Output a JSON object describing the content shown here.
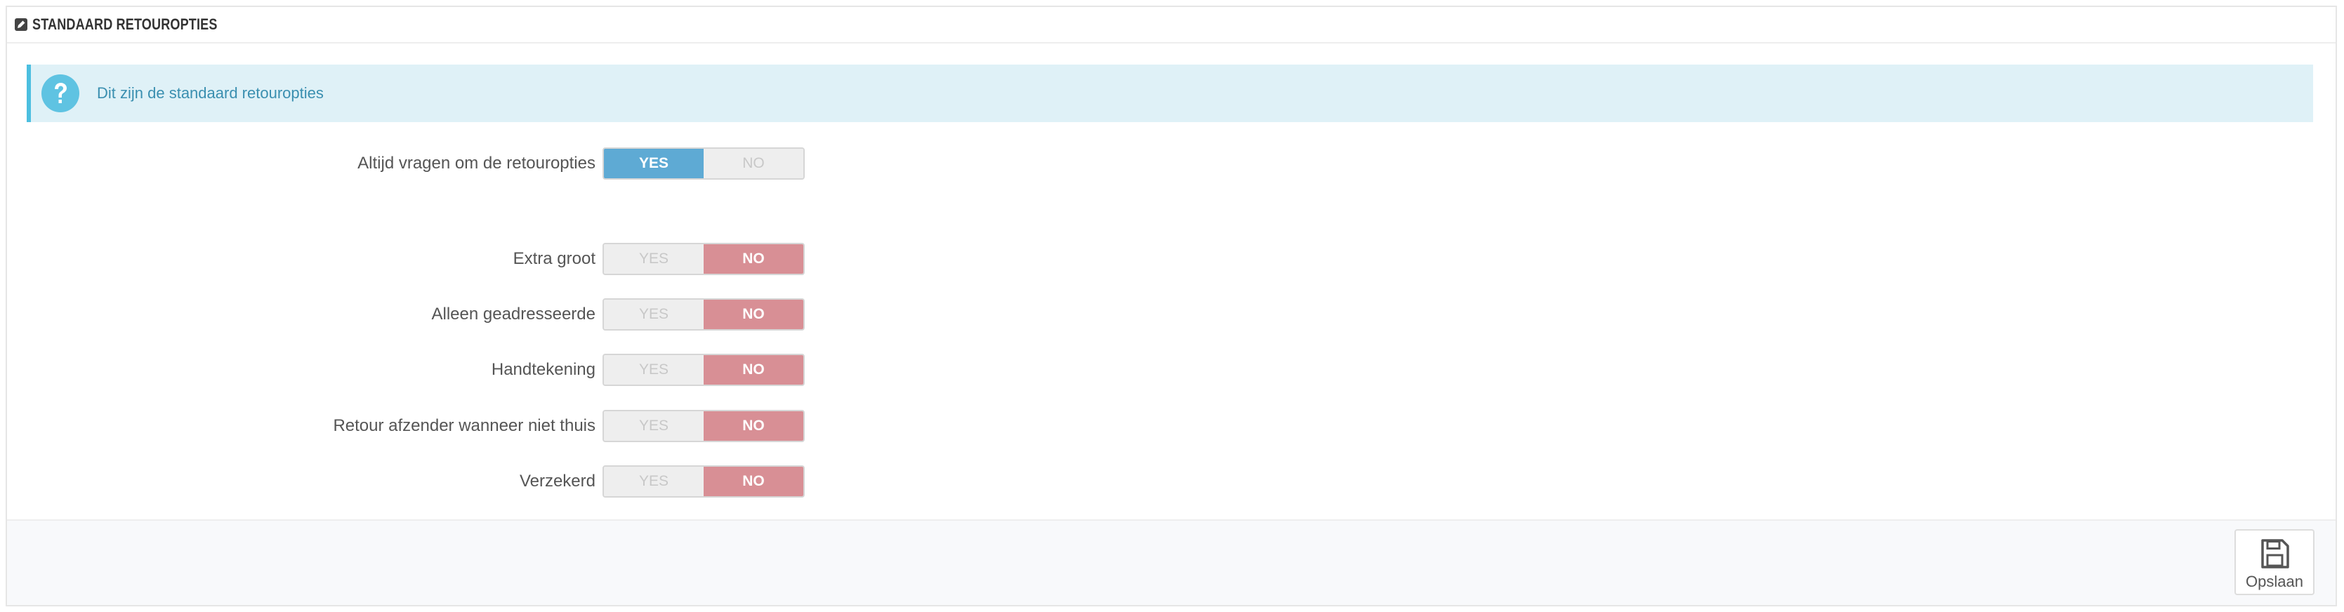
{
  "panel": {
    "title": "STANDAARD RETOUROPTIES",
    "title_icon": "pencil-square-icon"
  },
  "alert": {
    "icon": "question-circle-icon",
    "text": "Dit zijn de standaard retouropties",
    "color": "#dff1f7"
  },
  "switch_labels": {
    "yes": "YES",
    "no": "NO"
  },
  "options": [
    {
      "label": "Altijd vragen om de retouropties",
      "value": "YES"
    },
    {
      "label": "Extra groot",
      "value": "NO"
    },
    {
      "label": "Alleen geadresseerde",
      "value": "NO"
    },
    {
      "label": "Handtekening",
      "value": "NO"
    },
    {
      "label": "Retour afzender wanneer niet thuis",
      "value": "NO"
    },
    {
      "label": "Verzekerd",
      "value": "NO"
    }
  ],
  "colors": {
    "yes_active": "#5eaad4",
    "no_active": "#d88f95",
    "inactive": "#eeeeee"
  },
  "footer": {
    "save_label": "Opslaan",
    "save_icon": "floppy-disk-icon"
  }
}
